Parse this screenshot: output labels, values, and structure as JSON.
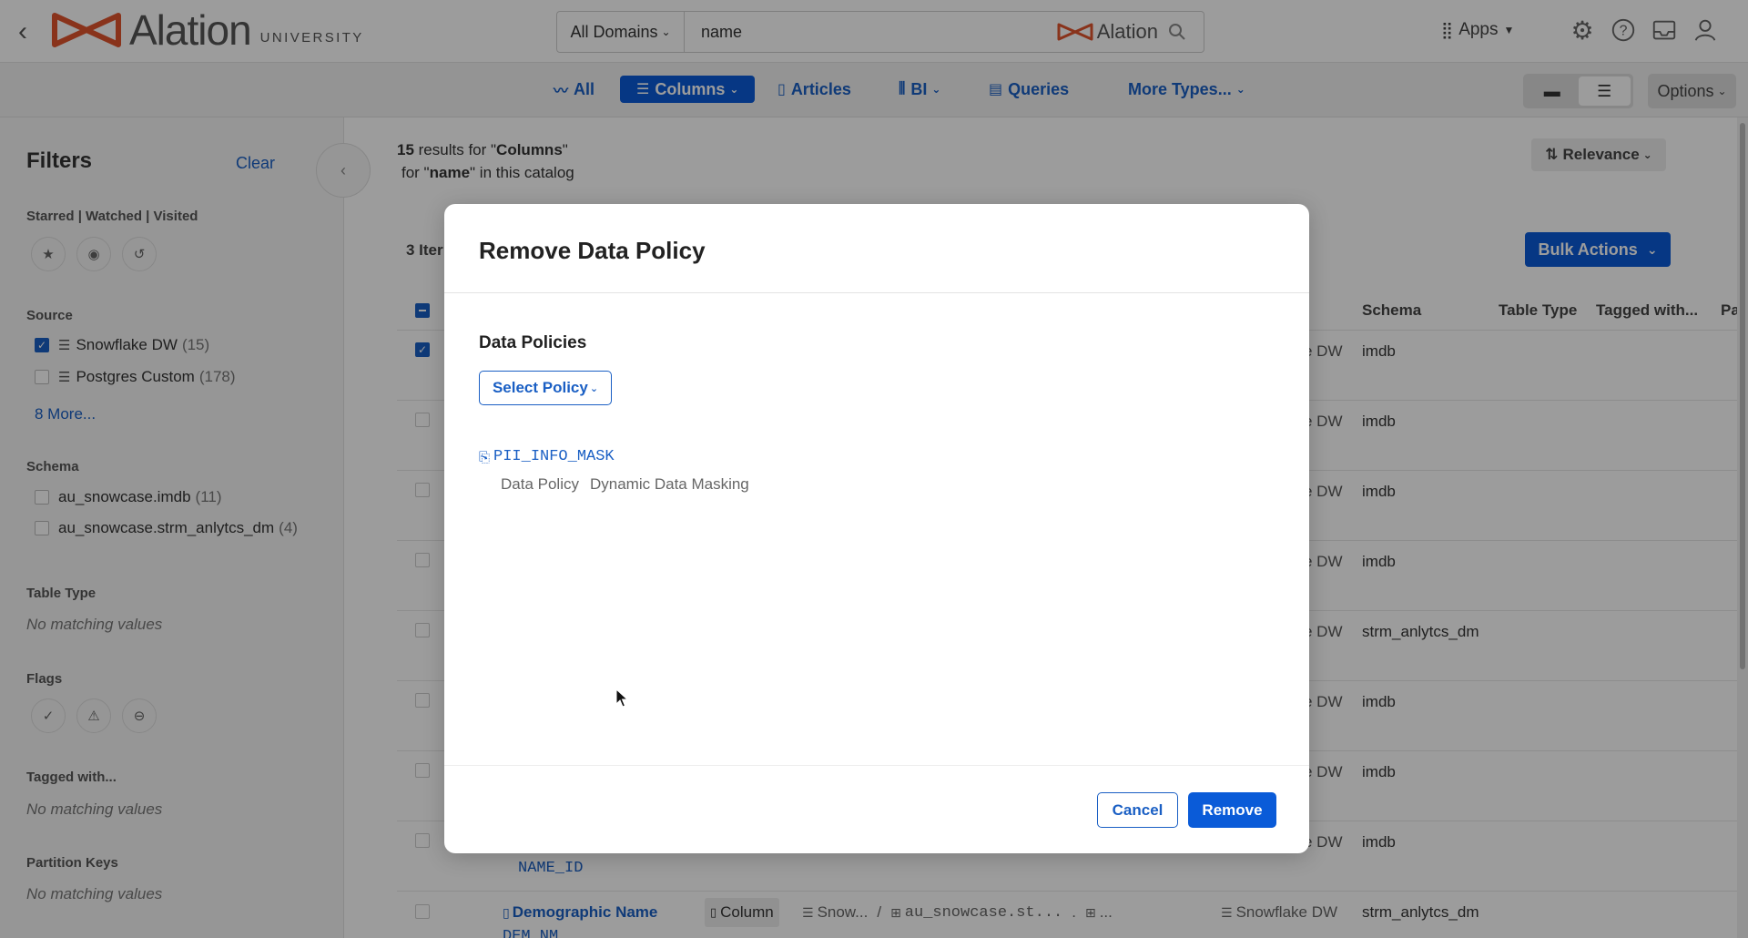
{
  "header": {
    "logo_word": "Alation",
    "logo_sub": "UNIVERSITY",
    "domain_filter": "All Domains",
    "search_value": "name",
    "search_brand": "Alation",
    "apps_label": "Apps"
  },
  "type_tabs": {
    "all": "All",
    "columns": "Columns",
    "articles": "Articles",
    "bi": "BI",
    "queries": "Queries",
    "more": "More Types..."
  },
  "options_label": "Options",
  "filters": {
    "title": "Filters",
    "clear": "Clear",
    "starred_label": "Starred | Watched | Visited",
    "source_label": "Source",
    "sources": [
      {
        "name": "Snowflake DW",
        "count": "(15)",
        "checked": true
      },
      {
        "name": "Postgres Custom",
        "count": "(178)",
        "checked": false
      }
    ],
    "more_sources": "8 More...",
    "schema_label": "Schema",
    "schemas": [
      {
        "name": "au_snowcase.imdb",
        "count": "(11)"
      },
      {
        "name": "au_snowcase.strm_anlytcs_dm",
        "count": "(4)"
      }
    ],
    "table_type_label": "Table Type",
    "table_type_empty": "No matching values",
    "flags_label": "Flags",
    "tagged_label": "Tagged with...",
    "tagged_empty": "No matching values",
    "partition_label": "Partition Keys",
    "partition_empty": "No matching values"
  },
  "results": {
    "count": "15",
    "results_for": " results for \"",
    "type": "Columns",
    "close_quote": "\"",
    "for_prefix": "for \"",
    "query": "name",
    "suffix": "\" in this catalog",
    "sort": "Relevance",
    "items_label": "3 Iter",
    "bulk_actions": "Bulk Actions",
    "columns": {
      "schema": "Schema",
      "table_type": "Table Type",
      "tagged": "Tagged with...",
      "pa": "Pa"
    },
    "rows": [
      {
        "source": "e DW",
        "schema": "imdb",
        "checked": true
      },
      {
        "source": "e DW",
        "schema": "imdb",
        "checked": false
      },
      {
        "source": "e DW",
        "schema": "imdb",
        "checked": false
      },
      {
        "source": "e DW",
        "schema": "imdb",
        "checked": false
      },
      {
        "source": "e DW",
        "schema": "strm_anlytcs_dm",
        "checked": false
      },
      {
        "source": "e DW",
        "schema": "imdb",
        "checked": false
      },
      {
        "source": "e DW",
        "schema": "imdb",
        "checked": false
      },
      {
        "source": "e DW",
        "schema": "imdb",
        "checked": false
      }
    ],
    "peek_id": "NAME_ID",
    "last_row": {
      "name": "Demographic Name",
      "type_badge": "Column",
      "path1": "Snow...",
      "sep": "/",
      "path2": "au_snowcase.st...",
      "dot": ".",
      "path3": "...",
      "source": "Snowflake DW",
      "schema": "strm_anlytcs_dm",
      "subtitle": "DEM_NM"
    }
  },
  "modal": {
    "title": "Remove Data Policy",
    "section_label": "Data Policies",
    "select_policy": "Select Policy",
    "policy_name": "PII_INFO_MASK",
    "policy_kind": "Data Policy",
    "policy_type": "Dynamic Data Masking",
    "cancel": "Cancel",
    "remove": "Remove"
  },
  "colors": {
    "accent": "#0a5bd8",
    "link": "#1a5fc4",
    "brand": "#e0542d"
  }
}
